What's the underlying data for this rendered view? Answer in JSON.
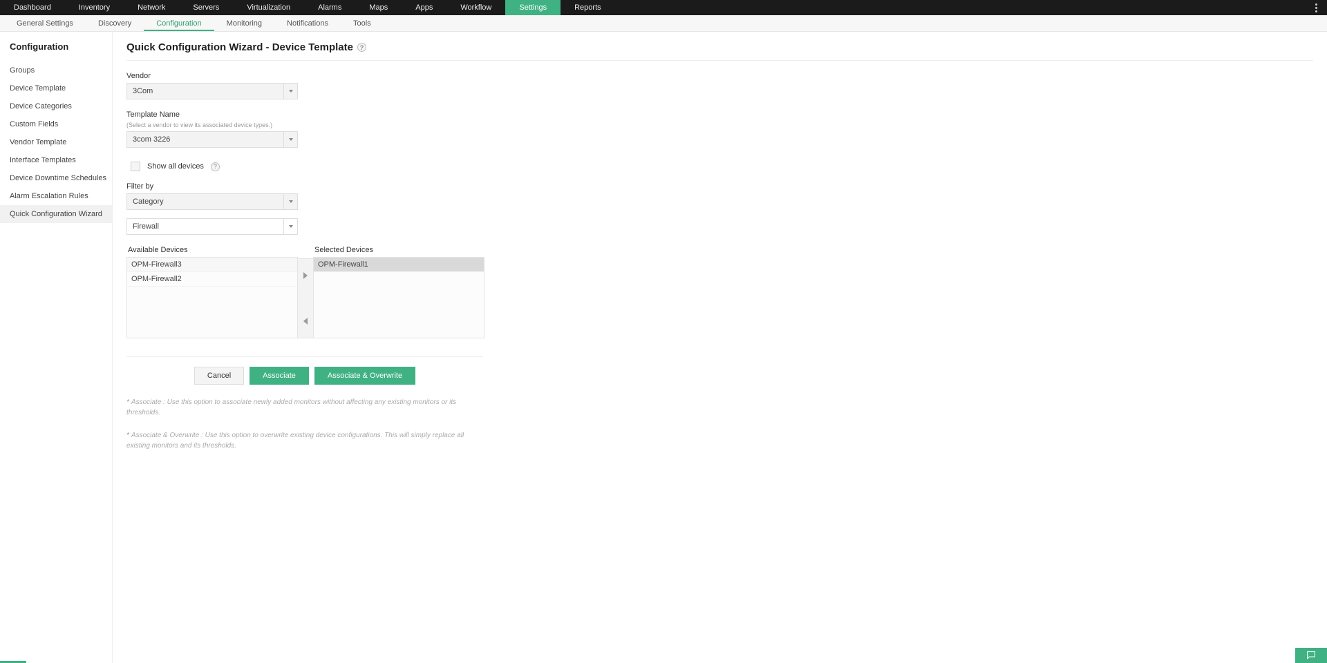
{
  "topnav": {
    "items": [
      "Dashboard",
      "Inventory",
      "Network",
      "Servers",
      "Virtualization",
      "Alarms",
      "Maps",
      "Apps",
      "Workflow",
      "Settings",
      "Reports"
    ],
    "active_index": 9
  },
  "subnav": {
    "items": [
      "General Settings",
      "Discovery",
      "Configuration",
      "Monitoring",
      "Notifications",
      "Tools"
    ],
    "active_index": 2
  },
  "sidebar": {
    "title": "Configuration",
    "items": [
      "Groups",
      "Device Template",
      "Device Categories",
      "Custom Fields",
      "Vendor Template",
      "Interface Templates",
      "Device Downtime Schedules",
      "Alarm Escalation Rules",
      "Quick Configuration Wizard"
    ],
    "active_index": 8
  },
  "page_title": "Quick Configuration Wizard - Device Template",
  "help_badge": "?",
  "fields": {
    "vendor_label": "Vendor",
    "vendor_value": "3Com",
    "template_label": "Template Name",
    "template_sublabel": "(Select a vendor to view its associated device types.)",
    "template_value": "3com 3226",
    "show_all_label": "Show all devices",
    "filter_label": "Filter by",
    "filter_value": "Category",
    "filter2_value": "Firewall"
  },
  "dual": {
    "available_label": "Available Devices",
    "selected_label": "Selected Devices",
    "available": [
      "OPM-Firewall3",
      "OPM-Firewall2"
    ],
    "selected": [
      "OPM-Firewall1"
    ]
  },
  "buttons": {
    "cancel": "Cancel",
    "associate": "Associate",
    "assoc_over": "Associate & Overwrite"
  },
  "notes": {
    "n1": "Associate : Use this option to associate newly added monitors without affecting any existing monitors or its thresholds.",
    "n2": "Associate & Overwrite : Use this option to overwrite existing device configurations. This will simply replace all existing monitors and its thresholds."
  }
}
